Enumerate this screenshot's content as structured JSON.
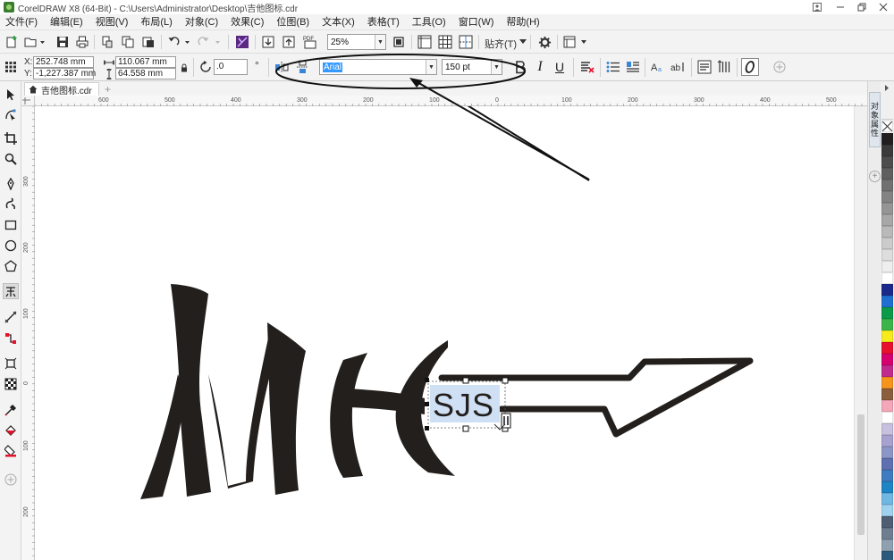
{
  "window": {
    "title": "CorelDRAW X8 (64-Bit) - C:\\Users\\Administrator\\Desktop\\吉他图标.cdr"
  },
  "menu": [
    {
      "label": "文件(F)"
    },
    {
      "label": "编辑(E)"
    },
    {
      "label": "视图(V)"
    },
    {
      "label": "布局(L)"
    },
    {
      "label": "对象(C)"
    },
    {
      "label": "效果(C)"
    },
    {
      "label": "位图(B)"
    },
    {
      "label": "文本(X)"
    },
    {
      "label": "表格(T)"
    },
    {
      "label": "工具(O)"
    },
    {
      "label": "窗口(W)"
    },
    {
      "label": "帮助(H)"
    }
  ],
  "toolbar": {
    "zoom": "25%",
    "snap_label": "贴齐(T)",
    "pdf_label": "PDF"
  },
  "properties": {
    "x_label": "X:",
    "x_value": "252.748 mm",
    "y_label": "Y:",
    "y_value": "-1,227.387 mm",
    "width_value": "110.067 mm",
    "height_value": "64.558 mm",
    "rotation_value": ".0",
    "rotation_unit": "°",
    "font_name": "Arial",
    "font_size": "150 pt",
    "bold_label": "B",
    "italic_label": "I",
    "underline_label": "U"
  },
  "document_tab": {
    "label": "吉他图标.cdr"
  },
  "rulers": {
    "h_ticks": [
      "600",
      "500",
      "400",
      "300",
      "200",
      "100",
      "0",
      "100",
      "200",
      "300",
      "400",
      "500",
      "600"
    ],
    "v_ticks": [
      "300",
      "200",
      "100",
      "0",
      "100",
      "200"
    ]
  },
  "dockers": {
    "object_properties_label": "对象属性"
  },
  "canvas": {
    "artwork_text": "SJS"
  },
  "palette": {
    "colors": [
      "#231f20",
      "#3b3b3b",
      "#4d4d4d",
      "#5f5f5f",
      "#717171",
      "#838383",
      "#959595",
      "#a7a7a7",
      "#b9b9b9",
      "#cbcbcb",
      "#dddddd",
      "#eeeeee",
      "#ffffff",
      "#1b2a8a",
      "#1f6fd1",
      "#0a9a48",
      "#39b54a",
      "#f7ec1b",
      "#e8112d",
      "#d6006e",
      "#c02a8e",
      "#f7941d",
      "#8b5e3c",
      "#f4a7b9",
      "#ffffff",
      "#c8c0df",
      "#a7a1cf",
      "#8c96c6",
      "#5f6fb0",
      "#3e7bc0",
      "#1d84c6",
      "#6fb8e3",
      "#9ed2ef",
      "#4e5e73",
      "#6d7e91",
      "#8fa0b1",
      "#2c5a7a"
    ]
  },
  "colors": {
    "accent": "#3399ff",
    "ink": "#231f1c"
  }
}
